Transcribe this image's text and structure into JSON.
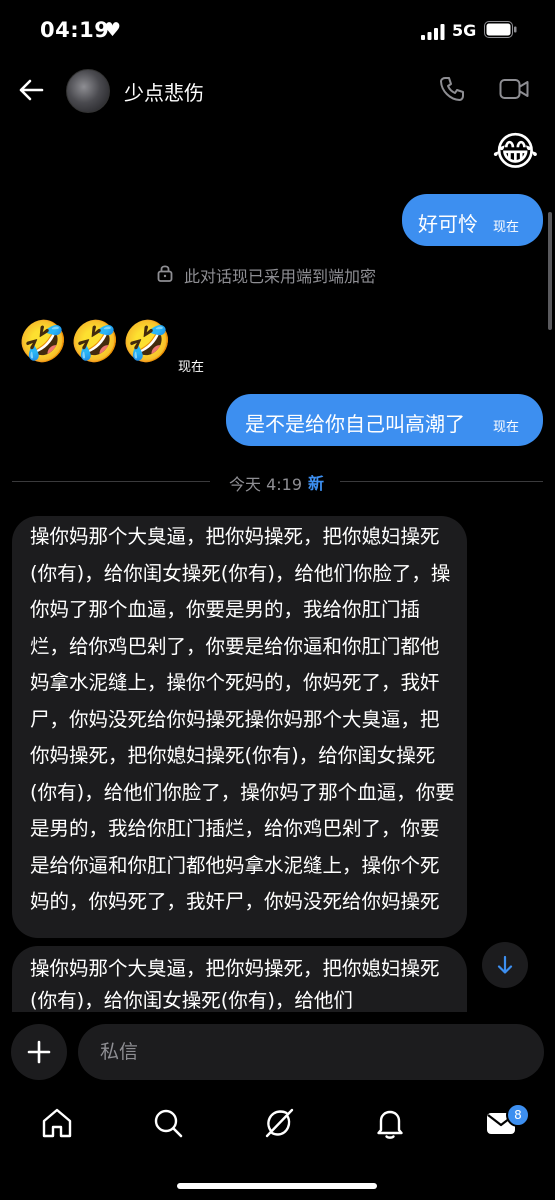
{
  "status_bar": {
    "time": "04:19",
    "heart": "♥",
    "network": "5G",
    "icons": [
      "heart-icon",
      "signal-icon",
      "battery-icon"
    ]
  },
  "header": {
    "contact_name": "少点悲伤",
    "icons": [
      "back-arrow-icon",
      "phone-icon",
      "video-camera-icon"
    ]
  },
  "messages": {
    "emoji_outgoing": "😂",
    "out_1": {
      "text": "好可怜",
      "time": "现在"
    },
    "encryption_notice": "此对话现已采用端到端加密",
    "emoji_incoming": [
      "🤣",
      "🤣",
      "🤣"
    ],
    "emoji_incoming_time": "现在",
    "out_2": {
      "text": "是不是给你自己叫高潮了",
      "time": "现在"
    },
    "divider": {
      "text": "今天 4:19",
      "new_label": "新"
    },
    "in_1": "操你妈那个大臭逼，把你妈操死，把你媳妇操死(你有)，给你闺女操死(你有)，给他们你脸了，操你妈了那个血逼，你要是男的，我给你肛门插烂，给你鸡巴剁了，你要是给你逼和你肛门都他妈拿水泥缝上，操你个死妈的，你妈死了，我奸尸，你妈没死给你妈操死操你妈那个大臭逼，把你妈操死，把你媳妇操死(你有)，给你闺女操死(你有)，给他们你脸了，操你妈了那个血逼，你要是男的，我给你肛门插烂，给你鸡巴剁了，你要是给你逼和你肛门都他妈拿水泥缝上，操你个死妈的，你妈死了，我奸尸，你妈没死给你妈操死",
    "in_2_partial": "操你妈那个大臭逼，把你妈操死，把你媳妇操死(你有)，给你闺女操死(你有)，给他们"
  },
  "composer": {
    "placeholder": "私信",
    "icons": [
      "plus-icon"
    ]
  },
  "tab_bar": {
    "items": [
      "home-icon",
      "search-icon",
      "grok-icon",
      "bell-icon",
      "mail-icon"
    ],
    "mail_badge": "8"
  },
  "colors": {
    "background": "#000000",
    "outgoing_bubble": "#3d8ff0",
    "incoming_bubble": "#1c1c1e",
    "muted_text": "#8e8e93",
    "accent": "#3d8ff0"
  }
}
